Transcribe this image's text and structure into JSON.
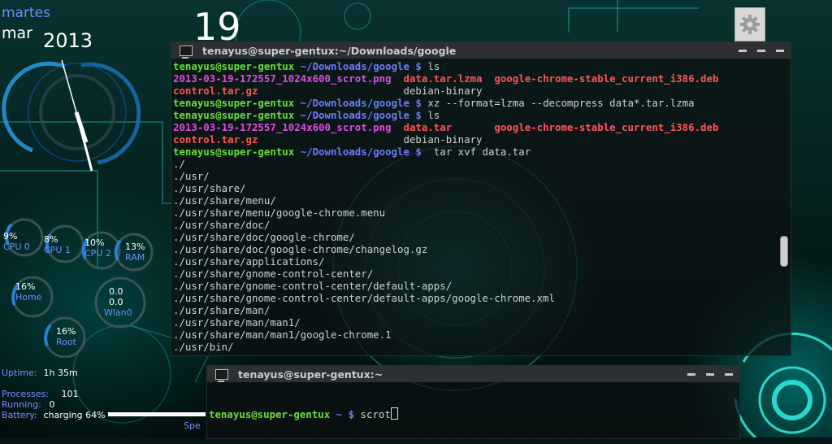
{
  "conky": {
    "day_name": "martes",
    "month": "mar",
    "year": "2013",
    "day_number": "19",
    "gauges": [
      {
        "value": "9%",
        "name": "CPU 0"
      },
      {
        "value": "8%",
        "name": "CPU 1"
      },
      {
        "value": "10%",
        "name": "CPU 2"
      },
      {
        "value": "13%",
        "name": "RAM"
      },
      {
        "value": "16%",
        "name": "Home"
      },
      {
        "value": "16%",
        "name": "Root"
      }
    ],
    "wlan": {
      "down": "0.0",
      "up": "0.0",
      "name": "Wlan0"
    },
    "stats": {
      "uptime_label": "Uptime:",
      "uptime": "1h 35m",
      "processes_label": "Processes:",
      "processes": "101",
      "running_label": "Running:",
      "running": "0",
      "battery_label": "Battery:",
      "battery": "charging 64%",
      "battery_level": 0.64,
      "trailing": "Spe"
    }
  },
  "settings_button": {
    "icon": "gear-icon"
  },
  "terminal_main": {
    "title": "tenayus@super-gentux:~/Downloads/google",
    "prompt_user": "tenayus@super-gentux",
    "prompt_dir": "~/Downloads/google",
    "prompt_sign": "$",
    "lines": [
      {
        "kind": "prompt",
        "cmd": "ls"
      },
      {
        "kind": "files",
        "a": "2013-03-19-172557_1024x600_scrot.png",
        "b": "data.tar.lzma",
        "c": "google-chrome-stable_current_i386.deb"
      },
      {
        "kind": "files2",
        "a": "control.tar.gz",
        "b": "debian-binary"
      },
      {
        "kind": "prompt",
        "cmd": "xz --format=lzma --decompress data*.tar.lzma"
      },
      {
        "kind": "prompt",
        "cmd": "ls"
      },
      {
        "kind": "files",
        "a": "2013-03-19-172557_1024x600_scrot.png",
        "b": "data.tar",
        "c": "google-chrome-stable_current_i386.deb"
      },
      {
        "kind": "files2",
        "a": "control.tar.gz",
        "b": "debian-binary"
      },
      {
        "kind": "prompt",
        "cmd": " tar xvf data.tar"
      },
      {
        "kind": "out",
        "text": "./"
      },
      {
        "kind": "out",
        "text": "./usr/"
      },
      {
        "kind": "out",
        "text": "./usr/share/"
      },
      {
        "kind": "out",
        "text": "./usr/share/menu/"
      },
      {
        "kind": "out",
        "text": "./usr/share/menu/google-chrome.menu"
      },
      {
        "kind": "out",
        "text": "./usr/share/doc/"
      },
      {
        "kind": "out",
        "text": "./usr/share/doc/google-chrome/"
      },
      {
        "kind": "out",
        "text": "./usr/share/doc/google-chrome/changelog.gz"
      },
      {
        "kind": "out",
        "text": "./usr/share/applications/"
      },
      {
        "kind": "out",
        "text": "./usr/share/gnome-control-center/"
      },
      {
        "kind": "out",
        "text": "./usr/share/gnome-control-center/default-apps/"
      },
      {
        "kind": "out",
        "text": "./usr/share/gnome-control-center/default-apps/google-chrome.xml"
      },
      {
        "kind": "out",
        "text": "./usr/share/man/"
      },
      {
        "kind": "out",
        "text": "./usr/share/man/man1/"
      },
      {
        "kind": "out",
        "text": "./usr/share/man/man1/google-chrome.1"
      },
      {
        "kind": "out",
        "text": "./usr/bin/"
      }
    ]
  },
  "terminal_small": {
    "title": "tenayus@super-gentux:~",
    "prompt_user": "tenayus@super-gentux",
    "prompt_dir": "~",
    "prompt_sign": "$",
    "cmd": "scrot"
  }
}
